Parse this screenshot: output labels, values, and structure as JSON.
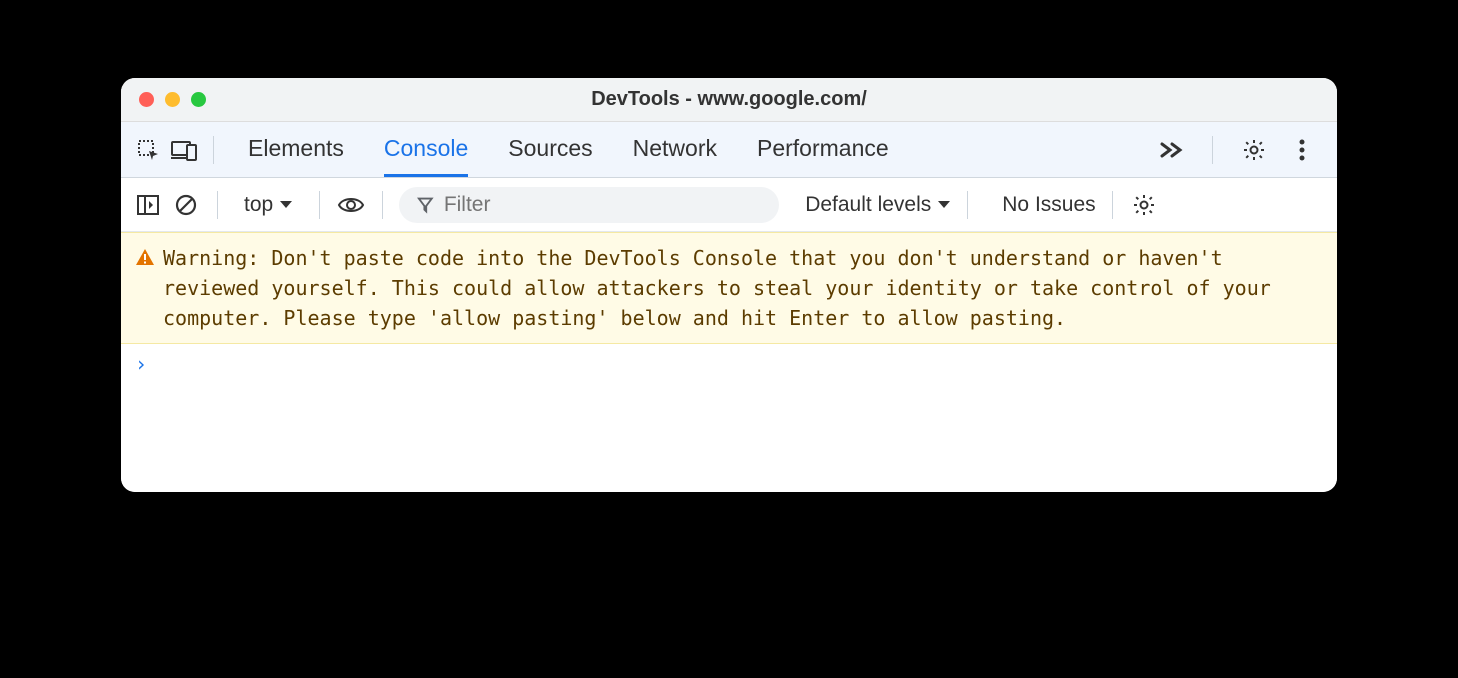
{
  "window": {
    "title": "DevTools - www.google.com/"
  },
  "tabs": {
    "items": [
      "Elements",
      "Console",
      "Sources",
      "Network",
      "Performance"
    ],
    "active_index": 1
  },
  "subbar": {
    "context": "top",
    "filter_placeholder": "Filter",
    "levels": "Default levels",
    "issues": "No Issues"
  },
  "console": {
    "warning": "Warning: Don't paste code into the DevTools Console that you don't understand or haven't reviewed yourself. This could allow attackers to steal your identity or take control of your computer. Please type 'allow pasting' below and hit Enter to allow pasting."
  }
}
